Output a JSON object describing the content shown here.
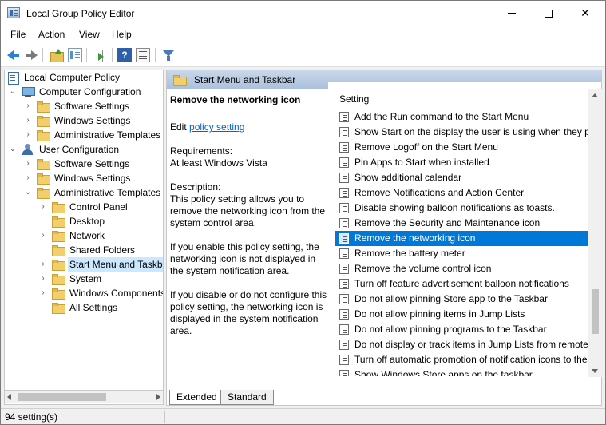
{
  "window": {
    "title": "Local Group Policy Editor",
    "minimize_glyph": "",
    "close_glyph": "✕"
  },
  "menu": {
    "items": [
      "File",
      "Action",
      "View",
      "Help"
    ]
  },
  "toolbar": {
    "icons": [
      "back-arrow-icon",
      "forward-arrow-icon",
      "up-folder-icon",
      "show-tree-icon",
      "export-list-icon",
      "help-icon",
      "properties-icon",
      "filter-icon"
    ],
    "help_label": "?"
  },
  "tree": {
    "rows": [
      {
        "label": "Local Computer Policy",
        "icon": "policy",
        "expander": ""
      },
      {
        "label": "Computer Configuration",
        "icon": "computer",
        "expander": "⌄"
      },
      {
        "label": "Software Settings",
        "icon": "folder",
        "expander": "›"
      },
      {
        "label": "Windows Settings",
        "icon": "folder",
        "expander": "›"
      },
      {
        "label": "Administrative Templates",
        "icon": "folder",
        "expander": "›"
      },
      {
        "label": "User Configuration",
        "icon": "user",
        "expander": "⌄"
      },
      {
        "label": "Software Settings",
        "icon": "folder",
        "expander": "›"
      },
      {
        "label": "Windows Settings",
        "icon": "folder",
        "expander": "›"
      },
      {
        "label": "Administrative Templates",
        "icon": "folder",
        "expander": "⌄"
      },
      {
        "label": "Control Panel",
        "icon": "folder",
        "expander": "›"
      },
      {
        "label": "Desktop",
        "icon": "folder",
        "expander": ""
      },
      {
        "label": "Network",
        "icon": "folder",
        "expander": "›"
      },
      {
        "label": "Shared Folders",
        "icon": "folder",
        "expander": ""
      },
      {
        "label": "Start Menu and Taskbar",
        "icon": "folder",
        "expander": "›",
        "selected": true
      },
      {
        "label": "System",
        "icon": "folder",
        "expander": "›"
      },
      {
        "label": "Windows Components",
        "icon": "folder",
        "expander": "›"
      },
      {
        "label": "All Settings",
        "icon": "folder",
        "expander": ""
      }
    ]
  },
  "details": {
    "header_title": "Start Menu and Taskbar",
    "policy_title": "Remove the networking icon",
    "edit_prefix": "Edit ",
    "edit_link": "policy setting",
    "requirements_label": "Requirements:",
    "requirements_value": "At least Windows Vista",
    "description_label": "Description:",
    "description_p1": "This policy setting allows you to remove the networking icon from the system control area.",
    "description_p2": "If you enable this policy setting, the networking icon is not displayed in the system notification area.",
    "description_p3": "If you disable or do not configure this policy setting, the networking icon is displayed in the system notification area."
  },
  "settings_list": {
    "column_header": "Setting",
    "rows": [
      "Add the Run command to the Start Menu",
      "Show Start on the display the user is using when they press the Windows logo key",
      "Remove Logoff on the Start Menu",
      "Pin Apps to Start when installed",
      "Show additional calendar",
      "Remove Notifications and Action Center",
      "Disable showing balloon notifications as toasts.",
      "Remove the Security and Maintenance icon",
      "Remove the networking icon",
      "Remove the battery meter",
      "Remove the volume control icon",
      "Turn off feature advertisement balloon notifications",
      "Do not allow pinning Store app to the Taskbar",
      "Do not allow pinning items in Jump Lists",
      "Do not allow pinning programs to the Taskbar",
      "Do not display or track items in Jump Lists from remote locations",
      "Turn off automatic promotion of notification icons to the taskbar",
      "Show Windows Store apps on the taskbar"
    ],
    "selected_index": 8
  },
  "tabs": [
    "Extended",
    "Standard"
  ],
  "status": {
    "text": "94 setting(s)"
  }
}
